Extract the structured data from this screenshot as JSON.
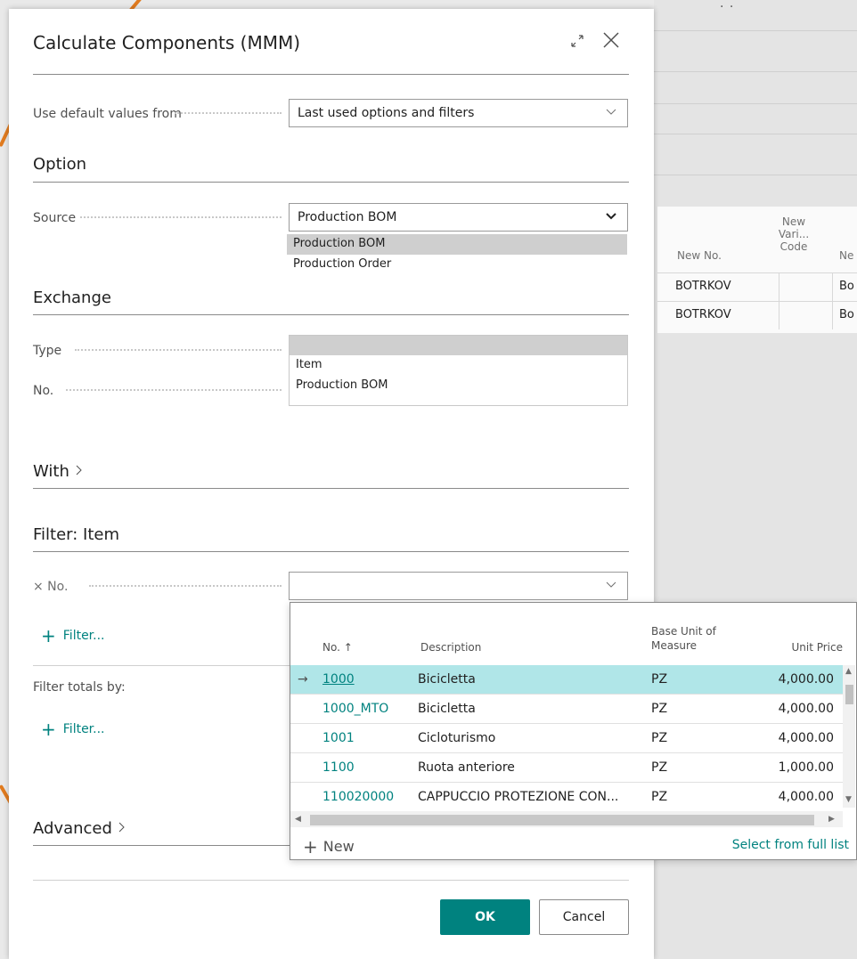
{
  "dialog": {
    "title": "Calculate Components (MMM)",
    "default_values_label": "Use default values from",
    "default_values_value": "Last used options and filters",
    "option_header": "Option",
    "source_label": "Source",
    "source_value": "Production BOM",
    "source_options": [
      "Production BOM",
      "Production Order"
    ],
    "exchange_header": "Exchange",
    "type_label": "Type",
    "type_options": [
      "",
      "Item",
      "Production BOM"
    ],
    "no_label": "No.",
    "with_header": "With",
    "filter_item_header": "Filter: Item",
    "filter_no_label": "× No.",
    "filter_link": "Filter...",
    "filter_totals_label": "Filter totals by:",
    "filter_totals_link": "Filter...",
    "advanced_header": "Advanced",
    "ok_button": "OK",
    "cancel_button": "Cancel"
  },
  "lookup": {
    "columns": [
      "No. ↑",
      "Description",
      "Base Unit of Measure",
      "Unit Price"
    ],
    "rows": [
      {
        "no": "1000",
        "description": "Bicicletta",
        "uom": "PZ",
        "price": "4,000.00",
        "active": true
      },
      {
        "no": "1000_MTO",
        "description": "Bicicletta",
        "uom": "PZ",
        "price": "4,000.00",
        "active": false
      },
      {
        "no": "1001",
        "description": "Cicloturismo",
        "uom": "PZ",
        "price": "4,000.00",
        "active": false
      },
      {
        "no": "1100",
        "description": "Ruota anteriore",
        "uom": "PZ",
        "price": "1,000.00",
        "active": false
      },
      {
        "no": "110020000",
        "description": "CAPPUCCIO PROTEZIONE CON...",
        "uom": "PZ",
        "price": "4,000.00",
        "active": false
      }
    ],
    "new_label": "New",
    "select_full_list": "Select from full list"
  },
  "background": {
    "col_new_no": "New No.",
    "col_new_variant": "New Vari... Code",
    "col_next": "Ne",
    "rows": [
      {
        "new_no": "BOTRKOV",
        "next": "Bo"
      },
      {
        "new_no": "BOTRKOV",
        "next": "Bo"
      }
    ]
  },
  "colors": {
    "accent": "#00827f",
    "selected_row": "#b0e6e8"
  }
}
